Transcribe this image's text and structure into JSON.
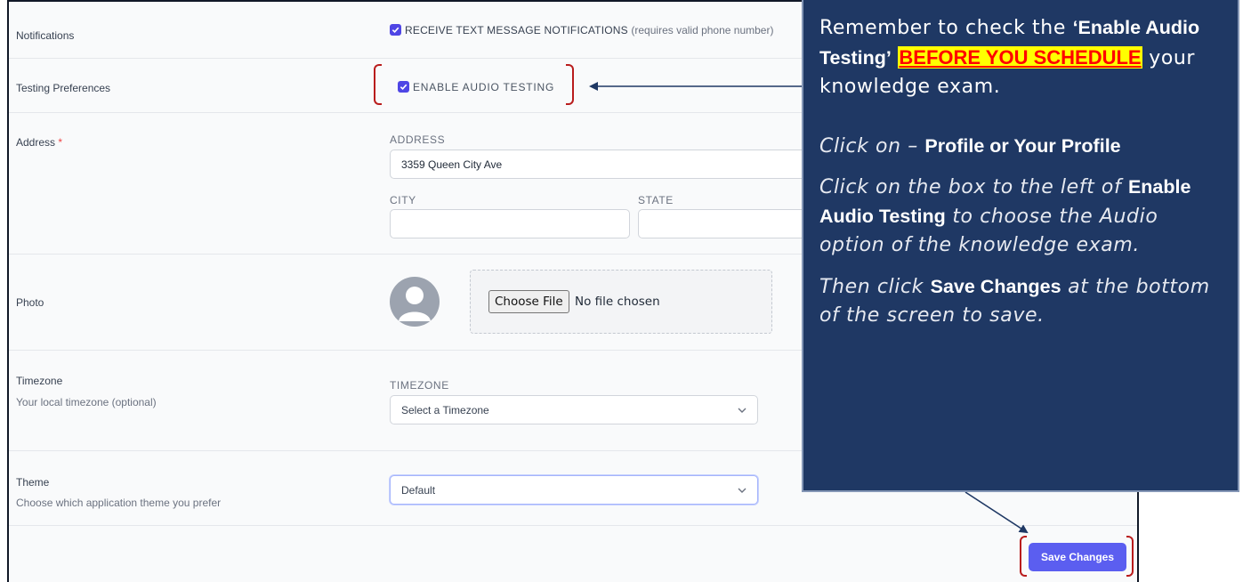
{
  "rows": {
    "notifications": {
      "label": "Notifications",
      "checkbox_label": "RECEIVE TEXT MESSAGE NOTIFICATIONS",
      "checkbox_hint": "(requires valid phone number)",
      "checked": true
    },
    "testing": {
      "label": "Testing Preferences",
      "checkbox_label": "ENABLE AUDIO TESTING",
      "checked": true
    },
    "address": {
      "label": "Address",
      "required_mark": "*",
      "address_caption": "ADDRESS",
      "address_value": "3359 Queen City Ave",
      "city_caption": "CITY",
      "city_value": "",
      "state_caption": "STATE",
      "state_value": ""
    },
    "photo": {
      "label": "Photo",
      "choose_button": "Choose File",
      "file_status": "No file chosen"
    },
    "timezone": {
      "label": "Timezone",
      "sublabel": "Your local timezone (optional)",
      "caption": "TIMEZONE",
      "selected": "Select a Timezone"
    },
    "theme": {
      "label": "Theme",
      "sublabel": "Choose which application theme you prefer",
      "selected": "Default"
    }
  },
  "save_button": "Save Changes",
  "callout": {
    "line1_pre": "Remember to check the ",
    "line1_bold": "‘Enable Audio Testing’",
    "line1_highlight": "BEFORE YOU SCHEDULE",
    "line1_post": " your knowledge exam.",
    "line2_italic": "Click on – ",
    "line2_bold": "Profile or Your Profile",
    "line3_italic_a": "Click on the box to the left of ",
    "line3_bold": "Enable Audio Testing",
    "line3_italic_b": " to choose the Audio option of the knowledge exam.",
    "line4_italic_a": "Then click ",
    "line4_bold": "Save Changes",
    "line4_italic_b": " at the bottom of the screen to save."
  },
  "colors": {
    "accent": "#4f46e5",
    "save_button": "#5b5ef0",
    "callout_bg": "#1f3864",
    "highlight_bg": "#ffff00",
    "highlight_text": "#ff0000",
    "bracket": "#b91c1c"
  }
}
